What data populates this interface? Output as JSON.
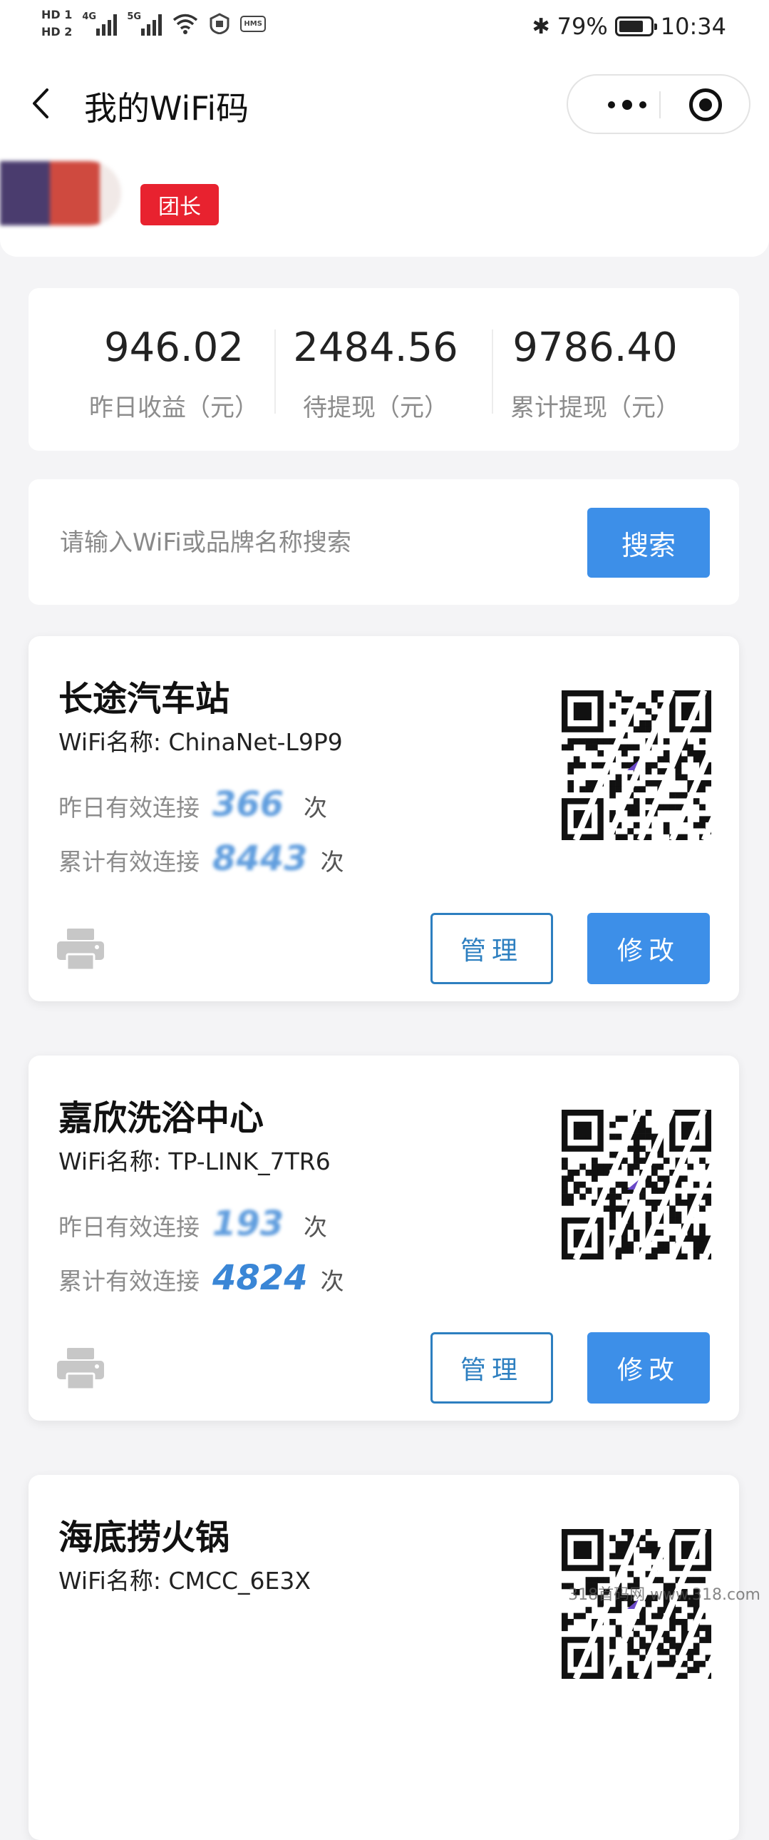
{
  "status_bar": {
    "hd1": "HD 1",
    "hd2": "HD 2",
    "sim1_net": "4G",
    "sim2_net": "5G",
    "hms": "HMS",
    "battery_percent": "79%",
    "battery_level": 0.79,
    "time": "10:34"
  },
  "nav": {
    "title": "我的WiFi码"
  },
  "profile": {
    "role_tag": "团长"
  },
  "stats": [
    {
      "value": "946.02",
      "label": "昨日收益（元）"
    },
    {
      "value": "2484.56",
      "label": "待提现（元）"
    },
    {
      "value": "9786.40",
      "label": "累计提现（元）"
    }
  ],
  "search": {
    "placeholder": "请输入WiFi或品牌名称搜索",
    "button": "搜索"
  },
  "cards": [
    {
      "name": "长途汽车站",
      "ssid": "WiFi名称: ChinaNet-L9P9",
      "yesterday_label": "昨日有效连接",
      "yesterday_value": "366",
      "total_label": "累计有效连接",
      "total_value": "8443",
      "unit": "次",
      "manage": "管理",
      "edit": "修改"
    },
    {
      "name": "嘉欣洗浴中心",
      "ssid": "WiFi名称: TP-LINK_7TR6",
      "yesterday_label": "昨日有效连接",
      "yesterday_value": "193",
      "total_label": "累计有效连接",
      "total_value": "4824",
      "unit": "次",
      "manage": "管理",
      "edit": "修改"
    },
    {
      "name": "海底捞火锅",
      "ssid": "WiFi名称: CMCC_6E3X"
    }
  ],
  "watermark": "318首码网 www.318.com",
  "colors": {
    "accent": "#3d8fe8",
    "manage_border": "#2d7fc0",
    "tag_red": "#e8222f",
    "background": "#f4f4f6",
    "count_blue": "#3a86d6"
  },
  "icons": [
    "back-icon",
    "more-icon",
    "close-target-icon",
    "printer-icon",
    "qr-code"
  ]
}
